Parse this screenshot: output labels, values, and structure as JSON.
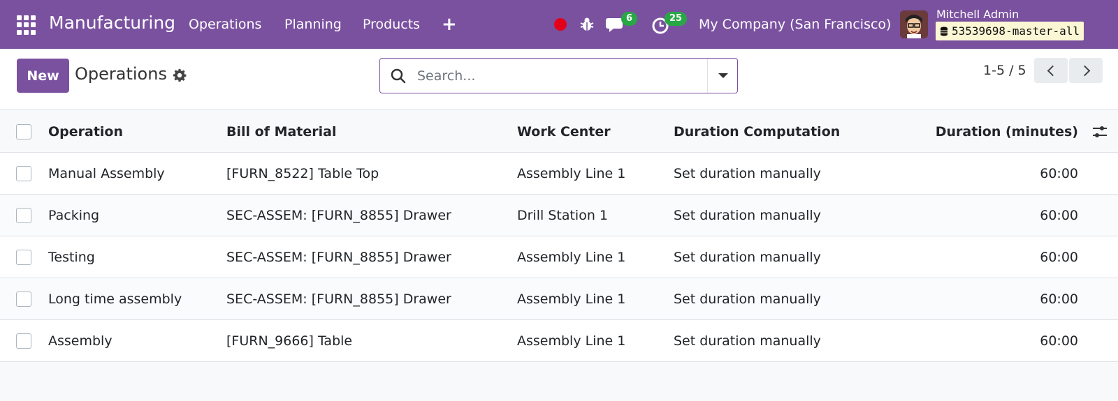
{
  "navbar": {
    "app_name": "Manufacturing",
    "menu": [
      {
        "label": "Operations"
      },
      {
        "label": "Planning"
      },
      {
        "label": "Products"
      }
    ],
    "plus_label": "+",
    "messages_count": "6",
    "activities_count": "25",
    "company": "My Company (San Francisco)",
    "user_name": "Mitchell Admin",
    "database": "53539698-master-all",
    "colors": {
      "primary": "#7a519f",
      "record": "#e3001b",
      "badge": "#28a745"
    }
  },
  "control_panel": {
    "new_label": "New",
    "title": "Operations",
    "search_placeholder": "Search...",
    "pager": "1-5 / 5"
  },
  "table": {
    "columns": {
      "operation": "Operation",
      "bom": "Bill of Material",
      "work_center": "Work Center",
      "duration_computation": "Duration Computation",
      "duration": "Duration (minutes)"
    },
    "rows": [
      {
        "operation": "Manual Assembly",
        "bom": "[FURN_8522] Table Top",
        "work_center": "Assembly Line 1",
        "duration_computation": "Set duration manually",
        "duration": "60:00"
      },
      {
        "operation": "Packing",
        "bom": "SEC-ASSEM: [FURN_8855] Drawer",
        "work_center": "Drill Station 1",
        "duration_computation": "Set duration manually",
        "duration": "60:00"
      },
      {
        "operation": "Testing",
        "bom": "SEC-ASSEM: [FURN_8855] Drawer",
        "work_center": "Assembly Line 1",
        "duration_computation": "Set duration manually",
        "duration": "60:00"
      },
      {
        "operation": "Long time assembly",
        "bom": "SEC-ASSEM: [FURN_8855] Drawer",
        "work_center": "Assembly Line 1",
        "duration_computation": "Set duration manually",
        "duration": "60:00"
      },
      {
        "operation": "Assembly",
        "bom": "[FURN_9666] Table",
        "work_center": "Assembly Line 1",
        "duration_computation": "Set duration manually",
        "duration": "60:00"
      }
    ]
  }
}
